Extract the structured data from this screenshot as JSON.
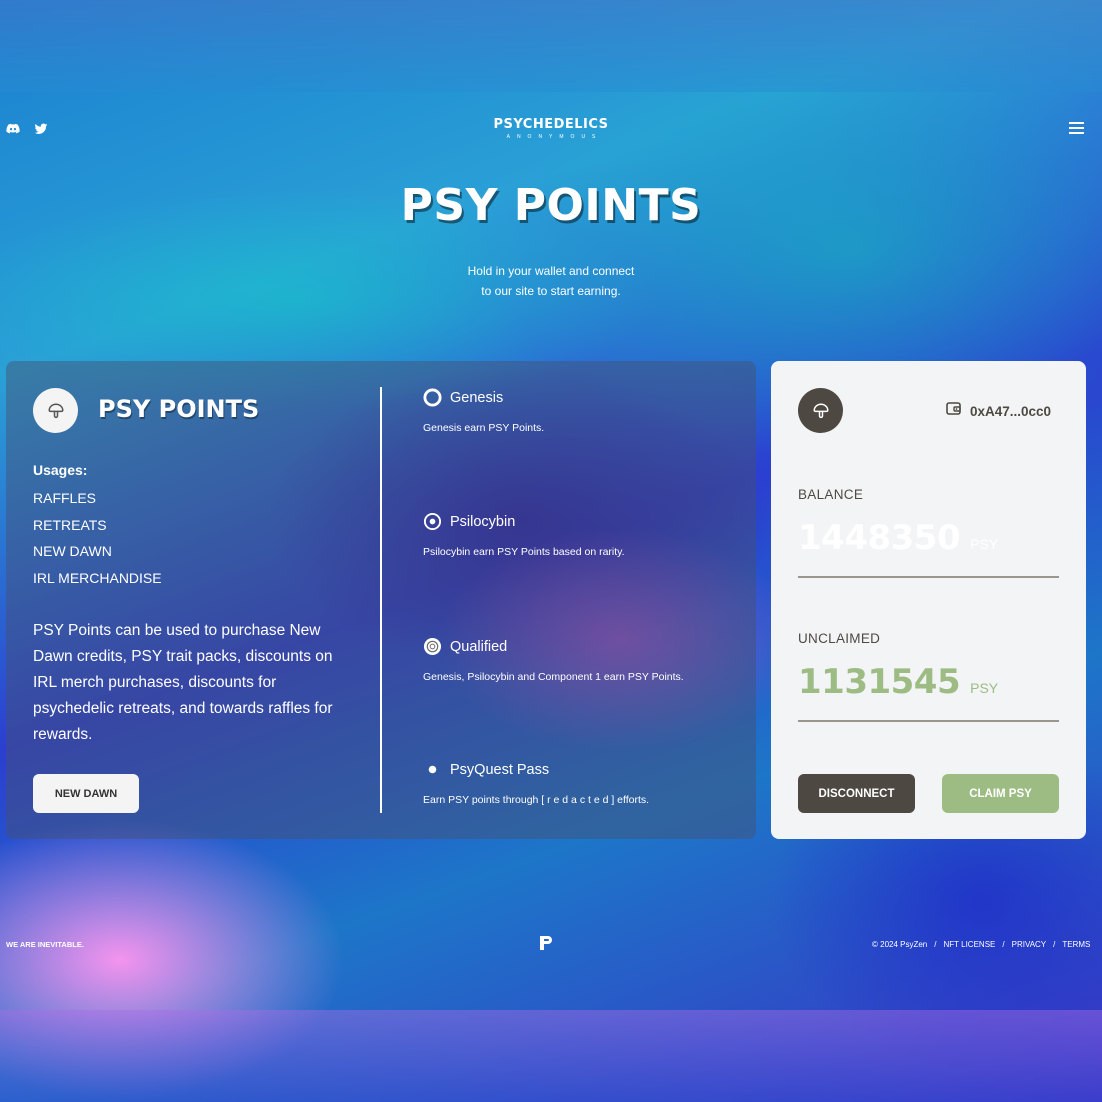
{
  "header": {
    "logo_line1": "PSYCHEDELICS",
    "logo_line2": "ANONYMOUS",
    "social_icons": [
      "discord-icon",
      "twitter-icon"
    ],
    "menu_icon": "hamburger-icon"
  },
  "hero": {
    "title": "PSY POINTS",
    "subtitle_line1": "Hold in your wallet and connect",
    "subtitle_line2": "to our site to start earning."
  },
  "info_card": {
    "title": "PSY POINTS",
    "usages_label": "Usages:",
    "usages": [
      "RAFFLES",
      "RETREATS",
      "NEW DAWN",
      "IRL MERCHANDISE"
    ],
    "description": "PSY Points can be used to purchase New Dawn credits, PSY trait packs, discounts on IRL merch purchases, discounts for psychedelic retreats, and towards raffles for rewards.",
    "button_label": "NEW DAWN",
    "tiers": [
      {
        "name": "Genesis",
        "icon": "ring-icon",
        "desc": "Genesis earn PSY Points."
      },
      {
        "name": "Psilocybin",
        "icon": "target-icon",
        "desc": "Psilocybin earn PSY Points based on rarity."
      },
      {
        "name": "Qualified",
        "icon": "coin-icon",
        "desc": "Genesis, Psilocybin and Component 1 earn PSY Points."
      },
      {
        "name": "PsyQuest Pass",
        "icon": "moon-phases-icon",
        "desc": "Earn PSY points through [ r e d a c t e d ] efforts."
      }
    ]
  },
  "wallet_card": {
    "address": "0xA47...0cc0",
    "balance_label": "BALANCE",
    "balance_value": "1448350",
    "balance_unit": "PSY",
    "unclaimed_label": "UNCLAIMED",
    "unclaimed_value": "1131545",
    "unclaimed_unit": "PSY",
    "disconnect_label": "DISCONNECT",
    "claim_label": "CLAIM PSY",
    "colors": {
      "dark": "#4d4942",
      "green": "#9cbc84",
      "card_bg": "#f3f4f6"
    }
  },
  "footer": {
    "tagline": "WE ARE INEVITABLE.",
    "copyright": "© 2024 PsyZen",
    "links": [
      "NFT LICENSE",
      "PRIVACY",
      "TERMS"
    ],
    "separator": "/"
  }
}
